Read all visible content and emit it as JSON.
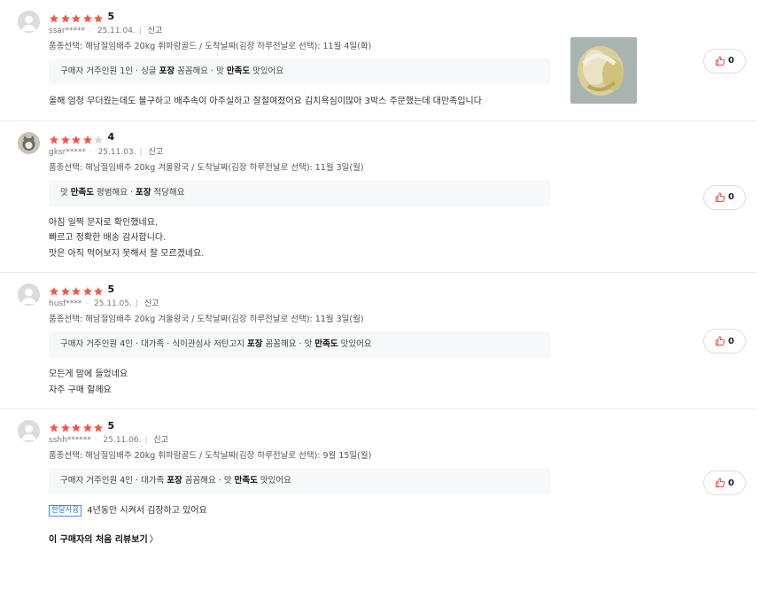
{
  "reviews": [
    {
      "score": "5",
      "stars_filled": 5,
      "user": "ssar*****",
      "date": "25.11.04.",
      "report": "신고",
      "option": "품종선택: 해남절임배추 20kg 휘파람골드 / 도착날짜(김장 하루전날로 선택): 11월 4일(화)",
      "survey": [
        {
          "text": "구매자 거주인원 1인 · 싱글 ",
          "bold": false
        },
        {
          "text": "포장",
          "bold": true
        },
        {
          "text": " 꼼꼼해요 · 맛 ",
          "bold": false
        },
        {
          "text": "만족도",
          "bold": true
        },
        {
          "text": " 맛있어요",
          "bold": false
        }
      ],
      "content_lines": [
        "올해 엄청 무더웠는데도 불구하고 배추속이 아주실하고 잘절여졌어요 김치욕심이많아 3박스 주문했는데 대만족입니다"
      ],
      "likes": "0",
      "has_photo": true
    },
    {
      "score": "4",
      "stars_filled": 4,
      "user": "gksr*****",
      "date": "25.11.03.",
      "report": "신고",
      "option": "품종선택: 해남절임배추 20kg 겨울왕국 / 도착날짜(김장 하루전날로 선택): 11월 3일(월)",
      "survey": [
        {
          "text": "맛 ",
          "bold": false
        },
        {
          "text": "만족도",
          "bold": true
        },
        {
          "text": " 평범해요 · ",
          "bold": false
        },
        {
          "text": "포장",
          "bold": true
        },
        {
          "text": " 적당해요",
          "bold": false
        }
      ],
      "content_lines": [
        "아침 일찍 문자로 확인했네요.",
        "빠르고 정확한 배송 감사합니다.",
        "맛은 아직 먹어보지 못해서 잘 모르겠네요."
      ],
      "likes": "0",
      "has_photo": false
    },
    {
      "score": "5",
      "stars_filled": 5,
      "user": "husf****",
      "date": "25.11.05.",
      "report": "신고",
      "option": "품종선택: 해남절임배추 20kg 겨울왕국 / 도착날짜(김장 하루전날로 선택): 11월 3일(월)",
      "survey": [
        {
          "text": "구매자 거주인원 4인 · 대가족 · 식이관심사 저탄고지 ",
          "bold": false
        },
        {
          "text": "포장",
          "bold": true
        },
        {
          "text": " 꼼꼼해요 · 맛 ",
          "bold": false
        },
        {
          "text": "만족도",
          "bold": true
        },
        {
          "text": " 맛있어요",
          "bold": false
        }
      ],
      "content_lines": [
        "모든게 맘에 들었네요",
        "자주 구매 할께요"
      ],
      "likes": "0",
      "has_photo": false
    },
    {
      "score": "5",
      "stars_filled": 5,
      "user": "sshh******",
      "date": "25.11.06.",
      "report": "신고",
      "option": "품종선택: 해남절임배추 20kg 휘파람골드 / 도착날짜(김장 하루전날로 선택): 9월 15일(월)",
      "survey": [
        {
          "text": "구매자 거주인원 4인 · 대가족 ",
          "bold": false
        },
        {
          "text": "포장",
          "bold": true
        },
        {
          "text": " 꼼꼼해요 · 맛 ",
          "bold": false
        },
        {
          "text": "만족도",
          "bold": true
        },
        {
          "text": " 맛있어요",
          "bold": false
        }
      ],
      "badge": "한달사용",
      "content_lines": [
        "4년동안 시켜서 김장하고 있어요"
      ],
      "likes": "0",
      "has_photo": false,
      "first_review_link": "이 구매자의 처음 리뷰보기"
    }
  ],
  "colors": {
    "star": "#f15746",
    "star_empty": "#d8d8d8",
    "like_icon": "#f04848",
    "badge": "#2f7ae5"
  },
  "icons": {
    "star": "star-icon",
    "like": "thumbs-up-icon",
    "avatar": "user-avatar-icon"
  }
}
